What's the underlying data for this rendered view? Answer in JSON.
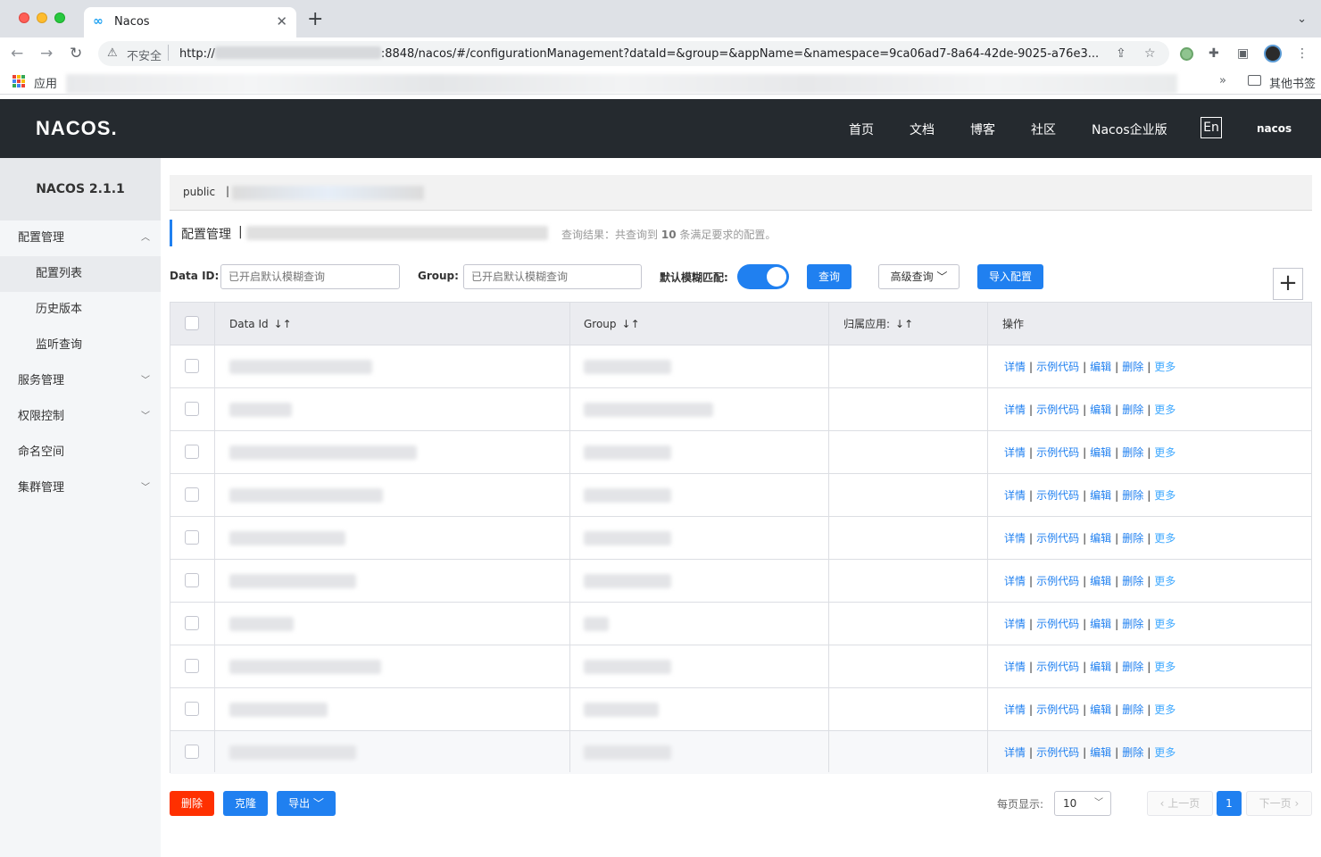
{
  "browser": {
    "tab_title": "Nacos",
    "insecure_label": "不安全",
    "url_prefix": "http://",
    "url_suffix": ":8848/nacos/#/configurationManagement?dataId=&group=&appName=&namespace=9ca06ad7-8a64-42de-9025-a76e3...",
    "bookmarks_apps": "应用",
    "bookmarks_other": "其他书签"
  },
  "header": {
    "logo_text": "NACOS.",
    "nav": [
      "首页",
      "文档",
      "博客",
      "社区",
      "Nacos企业版"
    ],
    "lang": "En",
    "user": "nacos"
  },
  "sidebar": {
    "version": "NACOS 2.1.1",
    "items": [
      {
        "label": "配置管理",
        "type": "group",
        "expanded": true
      },
      {
        "label": "配置列表",
        "type": "sub",
        "active": true
      },
      {
        "label": "历史版本",
        "type": "sub"
      },
      {
        "label": "监听查询",
        "type": "sub"
      },
      {
        "label": "服务管理",
        "type": "group",
        "expanded": false
      },
      {
        "label": "权限控制",
        "type": "group",
        "expanded": false
      },
      {
        "label": "命名空间",
        "type": "item"
      },
      {
        "label": "集群管理",
        "type": "group",
        "expanded": false
      }
    ]
  },
  "breadcrumb": {
    "namespace": "public",
    "separator": "|"
  },
  "page": {
    "title": "配置管理",
    "separator": "|",
    "query_result_prefix": "查询结果：共查询到",
    "query_result_count": "10",
    "query_result_suffix": "条满足要求的配置。"
  },
  "filters": {
    "data_id_label": "Data ID:",
    "data_id_placeholder": "已开启默认模糊查询",
    "group_label": "Group:",
    "group_placeholder": "已开启默认模糊查询",
    "fuzzy_label": "默认模糊匹配:",
    "fuzzy_enabled": true,
    "query_button": "查询",
    "advanced_button": "高级查询",
    "import_button": "导入配置"
  },
  "table": {
    "columns": [
      "Data Id",
      "Group",
      "归属应用:",
      "操作"
    ],
    "row_count": 10,
    "actions": [
      "详情",
      "示例代码",
      "编辑",
      "删除",
      "更多"
    ]
  },
  "bottom": {
    "delete_button": "删除",
    "clone_button": "克隆",
    "export_button": "导出",
    "page_size_label": "每页显示:",
    "page_size": "10",
    "prev_button": "上一页",
    "current_page": "1",
    "next_button": "下一页"
  },
  "colors": {
    "primary": "#2080f0",
    "danger": "#ff3000",
    "header_bg": "#252a2f",
    "sidebar_bg": "#f4f6f8"
  }
}
